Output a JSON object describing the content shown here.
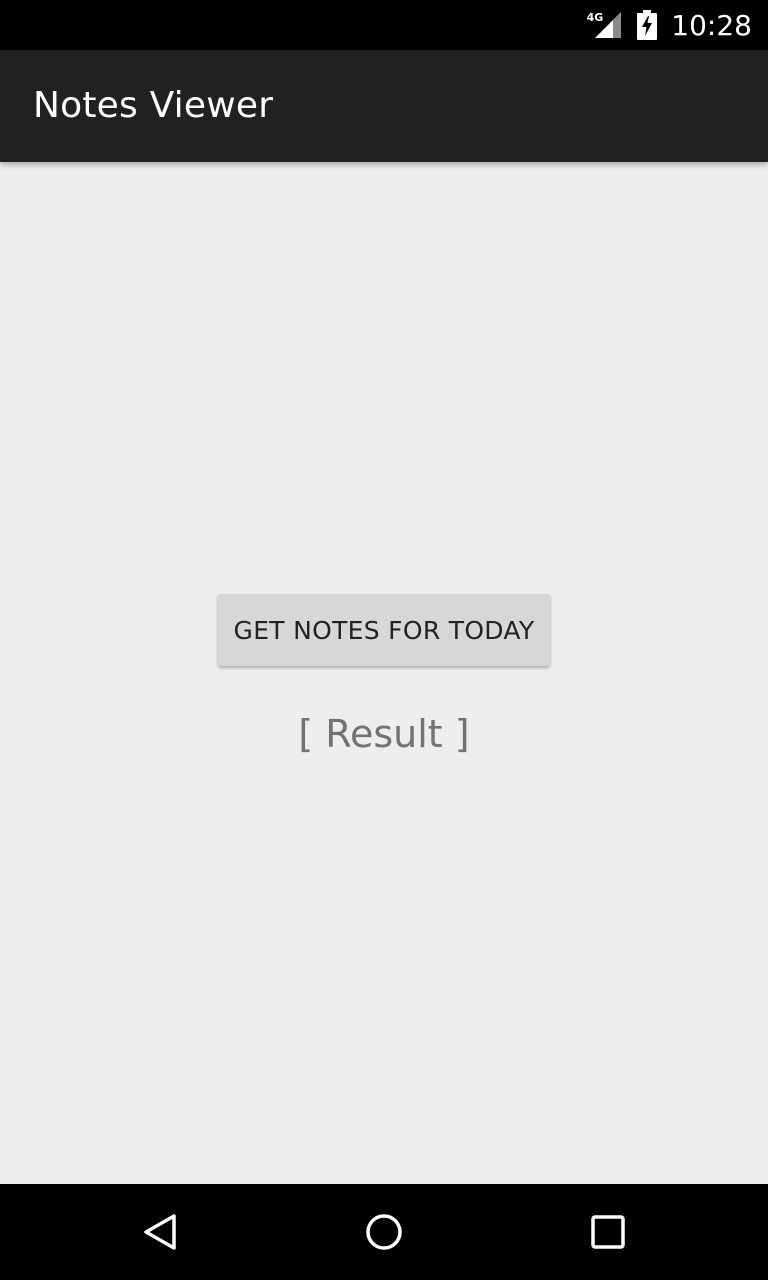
{
  "status_bar": {
    "network_type": "4G",
    "signal_icon": "signal-icon",
    "battery_icon": "battery-charging-icon",
    "time": "10:28"
  },
  "app_bar": {
    "title": "Notes Viewer"
  },
  "main": {
    "button_label": "GET NOTES FOR TODAY",
    "result_text": "[ Result ]"
  },
  "nav_bar": {
    "back_icon": "back-triangle-icon",
    "home_icon": "home-circle-icon",
    "recent_icon": "recent-apps-square-icon"
  },
  "colors": {
    "status_bar_bg": "#000000",
    "app_bar_bg": "#212121",
    "content_bg": "#eeeeee",
    "button_bg": "#d6d7d7",
    "result_text": "#737373"
  }
}
